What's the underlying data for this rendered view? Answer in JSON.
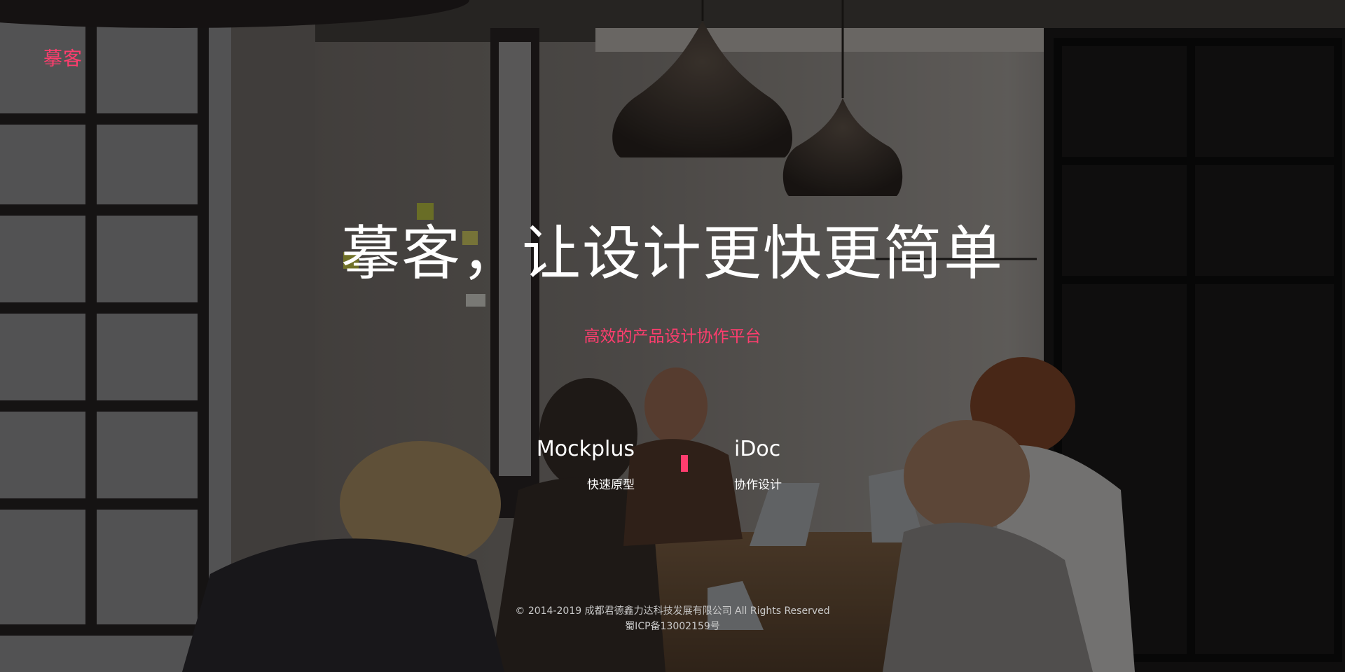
{
  "colors": {
    "accent": "#ff3d6e",
    "text": "#ffffff",
    "footer_text": "#c9c9c9"
  },
  "header": {
    "logo_text": "摹客"
  },
  "hero": {
    "title": "摹客，让设计更快更简单",
    "subtitle": "高效的产品设计协作平台"
  },
  "products": [
    {
      "name": "Mockplus",
      "description": "快速原型"
    },
    {
      "name": "iDoc",
      "description": "协作设计"
    }
  ],
  "footer": {
    "copyright": "© 2014-2019 成都君德鑫力达科技发展有限公司 All Rights Reserved",
    "icp": "蜀ICP备13002159号"
  }
}
